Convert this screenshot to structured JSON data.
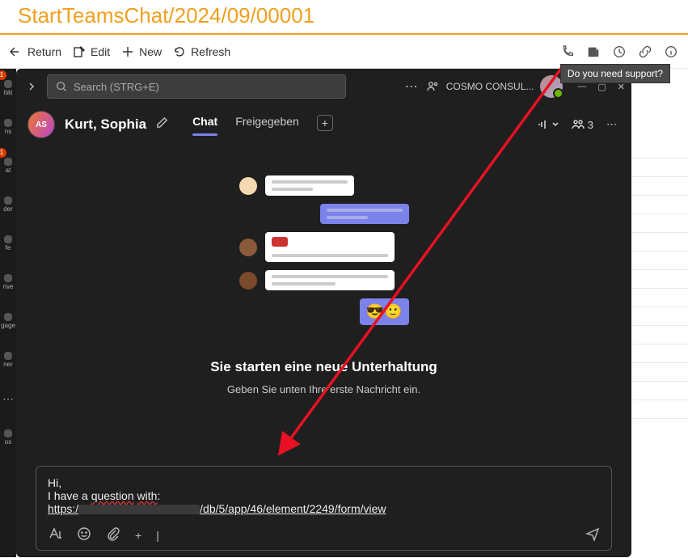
{
  "page_title": "StartTeamsChat/2024/09/00001",
  "host_toolbar": {
    "return": "Return",
    "edit": "Edit",
    "new": "New",
    "refresh": "Refresh",
    "tooltip": "Do you need support?"
  },
  "rail": {
    "badge1": "1",
    "label1": "ität",
    "label2": "ns",
    "badge2": "1",
    "label3": "at",
    "label4": "der",
    "label5": "fe",
    "label6": "rive",
    "label7": "gage",
    "label8": "ner",
    "label9": "os"
  },
  "teams_top": {
    "search_placeholder": "Search (STRG+E)",
    "org": "COSMO CONSUL..."
  },
  "chat_header": {
    "avatar_initials": "AS",
    "name": "Kurt, Sophia",
    "tab_chat": "Chat",
    "tab_shared": "Freigegeben",
    "participants_count": "3"
  },
  "empty_state": {
    "title": "Sie starten eine neue Unterhaltung",
    "subtitle": "Geben Sie unten Ihre erste Nachricht ein.",
    "emoji_sunglasses": "😎",
    "emoji_smile": "🙂"
  },
  "compose": {
    "line1": "Hi,",
    "line2a": "I have a ",
    "line2b": "question",
    "line2c": " ",
    "line2d": "with",
    "line2e": ":",
    "url_prefix": "https:/",
    "url_suffix": "/db/5/app/46/element/2249/form/view"
  }
}
